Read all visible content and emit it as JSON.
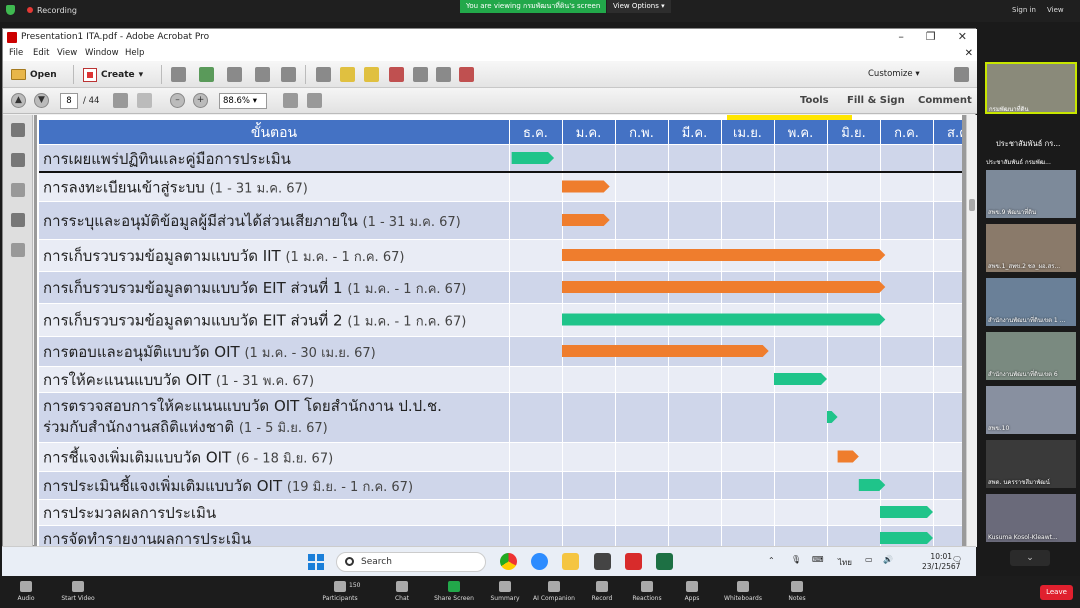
{
  "zoom_top": {
    "recording": "Recording",
    "viewing": "You are viewing กรมพัฒนาที่ดิน's screen",
    "view_options": "View Options",
    "sign_in": "Sign in",
    "view": "View"
  },
  "acrobat": {
    "title": "Presentation1 ITA.pdf - Adobe Acrobat Pro",
    "menu": [
      "File",
      "Edit",
      "View",
      "Window",
      "Help"
    ],
    "toolbar": {
      "open": "Open",
      "create": "Create",
      "customize": "Customize"
    },
    "nav": {
      "page": "8",
      "total": "/ 44",
      "zoom": "88.6%"
    },
    "right_buttons": [
      "Tools",
      "Fill & Sign",
      "Comment"
    ]
  },
  "chart_data": {
    "type": "gantt",
    "step_header": "ขั้นตอน",
    "months": [
      "ธ.ค.",
      "ม.ค.",
      "ก.พ.",
      "มี.ค.",
      "เม.ย.",
      "พ.ค.",
      "มิ.ย.",
      "ก.ค.",
      "ส.ค."
    ],
    "tasks": [
      {
        "name": "การเผยแพร่ปฏิทินและคู่มือการประเมิน",
        "date": "",
        "start": 0.05,
        "end": 0.85,
        "color": "#1fc48a"
      },
      {
        "name": "การลงทะเบียนเข้าสู่ระบบ",
        "date": "(1 - 31 ม.ค. 67)",
        "start": 1.0,
        "end": 1.9,
        "color": "#ef7d2d"
      },
      {
        "name": "การระบุและอนุมัติข้อมูลผู้มีส่วนได้ส่วนเสียภายใน",
        "date": "(1 - 31 ม.ค. 67)",
        "start": 1.0,
        "end": 1.9,
        "color": "#ef7d2d"
      },
      {
        "name": "การเก็บรวบรวมข้อมูลตามแบบวัด IIT",
        "date": "(1 ม.ค. - 1 ก.ค. 67)",
        "start": 1.0,
        "end": 7.1,
        "color": "#ef7d2d"
      },
      {
        "name": "การเก็บรวบรวมข้อมูลตามแบบวัด EIT ส่วนที่ 1",
        "date": "(1 ม.ค. - 1 ก.ค. 67)",
        "start": 1.0,
        "end": 7.1,
        "color": "#ef7d2d"
      },
      {
        "name": "การเก็บรวบรวมข้อมูลตามแบบวัด EIT ส่วนที่ 2",
        "date": "(1 ม.ค. - 1 ก.ค. 67)",
        "start": 1.0,
        "end": 7.1,
        "color": "#1fc48a"
      },
      {
        "name": "การตอบและอนุมัติแบบวัด OIT",
        "date": "(1 ม.ค. - 30 เม.ย. 67)",
        "start": 1.0,
        "end": 4.9,
        "color": "#ef7d2d"
      },
      {
        "name": "การให้คะแนนแบบวัด OIT",
        "date": "(1 - 31 พ.ค. 67)",
        "start": 5.0,
        "end": 6.0,
        "color": "#1fc48a"
      },
      {
        "name": "การตรวจสอบการให้คะแนนแบบวัด OIT โดยสำนักงาน ป.ป.ช. ร่วมกับสำนักงานสถิติแห่งชาติ",
        "date": "(1 - 5 มิ.ย. 67)",
        "start": 6.0,
        "end": 6.2,
        "color": "#1fc48a"
      },
      {
        "name": "การชี้แจงเพิ่มเติมแบบวัด OIT",
        "date": "(6 - 18 มิ.ย. 67)",
        "start": 6.2,
        "end": 6.6,
        "color": "#ef7d2d"
      },
      {
        "name": "การประเมินชี้แจงเพิ่มเติมแบบวัด OIT",
        "date": "(19 มิ.ย. - 1 ก.ค. 67)",
        "start": 6.6,
        "end": 7.1,
        "color": "#1fc48a"
      },
      {
        "name": "การประมวลผลการประเมิน",
        "date": "",
        "start": 7.0,
        "end": 8.0,
        "color": "#1fc48a"
      },
      {
        "name": "การจัดทำรายงานผลการประเมิน",
        "date": "",
        "start": 7.0,
        "end": 8.0,
        "color": "#1fc48a"
      }
    ],
    "colors": {
      "header": "#4472c4",
      "row_a": "#cfd6ea",
      "row_b": "#e9ecf5",
      "orange": "#ef7d2d",
      "green": "#1fc48a"
    }
  },
  "taskbar": {
    "search": "Search",
    "lang": "ไทย",
    "time": "10:01",
    "date": "23/1/2567"
  },
  "zoom_controls": {
    "audio": "Audio",
    "video": "Start Video",
    "participants": "Participants",
    "participants_count": "150",
    "chat": "Chat",
    "share": "Share Screen",
    "summary": "Summary",
    "ai": "AI Companion",
    "record": "Record",
    "reactions": "Reactions",
    "apps": "Apps",
    "whiteboards": "Whiteboards",
    "notes": "Notes",
    "leave": "Leave"
  },
  "gallery": {
    "self_name": "กรมพัฒนาที่ดิน",
    "title": "ประชาสัมพันธ์ กร...",
    "tiles": [
      "ประชาสัมพันธ์ กรมพัฒ...",
      "สพข.9 พัฒนาที่ดิน",
      "สพข.1_สพข.2 ชล_ผอ.สร...",
      "สำนักงานพัฒนาที่ดินเขต 1 ...",
      "สำนักงานพัฒนาที่ดินเขต 6",
      "สพข.10",
      "สพด. นครราชสีมาพัฒน์",
      "Kusuma Kosol-Kleawt..."
    ]
  }
}
